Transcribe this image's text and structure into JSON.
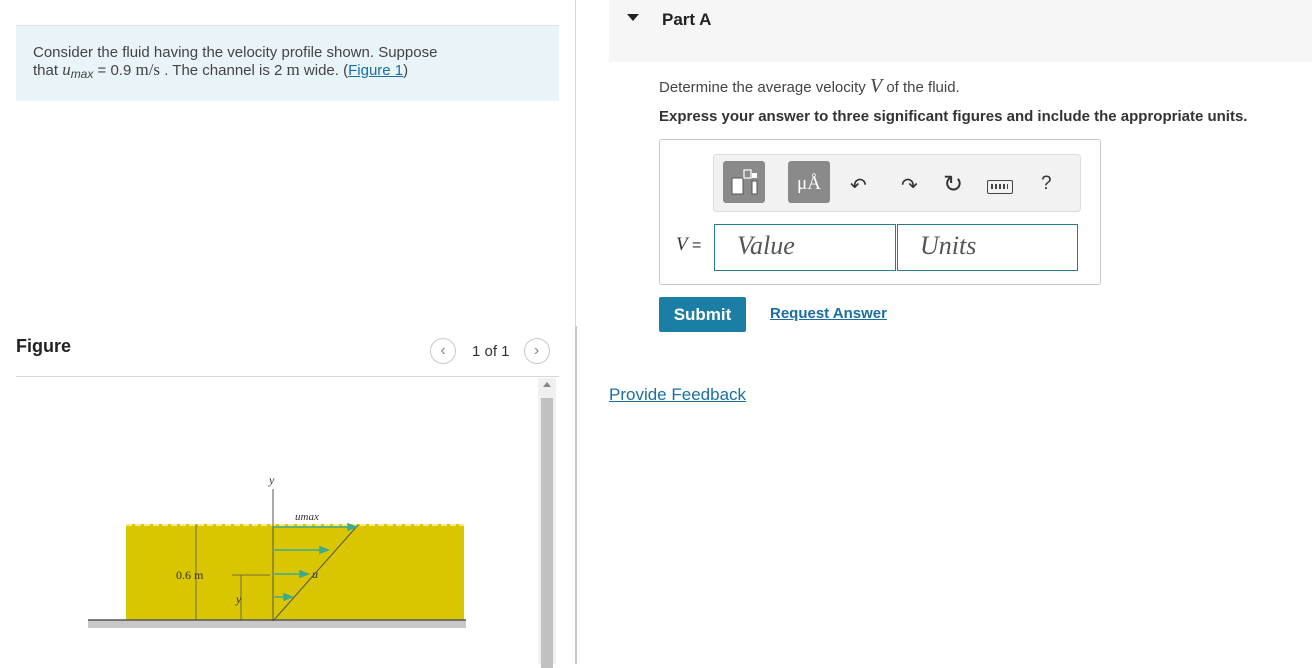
{
  "problem": {
    "line1": "Consider the fluid having the velocity profile shown. Suppose",
    "line2_prefix": "that ",
    "umax_var": "u",
    "umax_sub": "max",
    "line2_mid": " = 0.9 ",
    "speed_unit": "m/s",
    "line2_mid2": " . The channel is 2 ",
    "width_unit": "m",
    "line2_suffix": " wide. (",
    "figure_link": "Figure 1",
    "close_paren": ")"
  },
  "figure": {
    "title": "Figure",
    "pager": "1 of 1",
    "labels": {
      "y_axis": "y",
      "umax": "umax",
      "u": "u",
      "depth": "0.6 m",
      "y": "y"
    },
    "colors": {
      "fluid": "#d9c600",
      "arrow": "#3aaa92",
      "ground": "#c8c8c8"
    }
  },
  "part": {
    "title": "Part A",
    "question_prefix": "Determine the average velocity ",
    "question_var": "V",
    "question_suffix": " of the fluid.",
    "instruction": "Express your answer to three significant figures and include the appropriate units.",
    "toolbar": {
      "units_glyph": "μÅ",
      "help_glyph": "?",
      "undo_glyph": "↶",
      "redo_glyph": "↷",
      "reset_glyph": "↻"
    },
    "eq_var": "V",
    "eq_sign": " =",
    "value_placeholder": "Value",
    "units_placeholder": "Units",
    "submit": "Submit",
    "request_answer": "Request Answer"
  },
  "feedback": "Provide Feedback",
  "accent": "#1b7ea4"
}
